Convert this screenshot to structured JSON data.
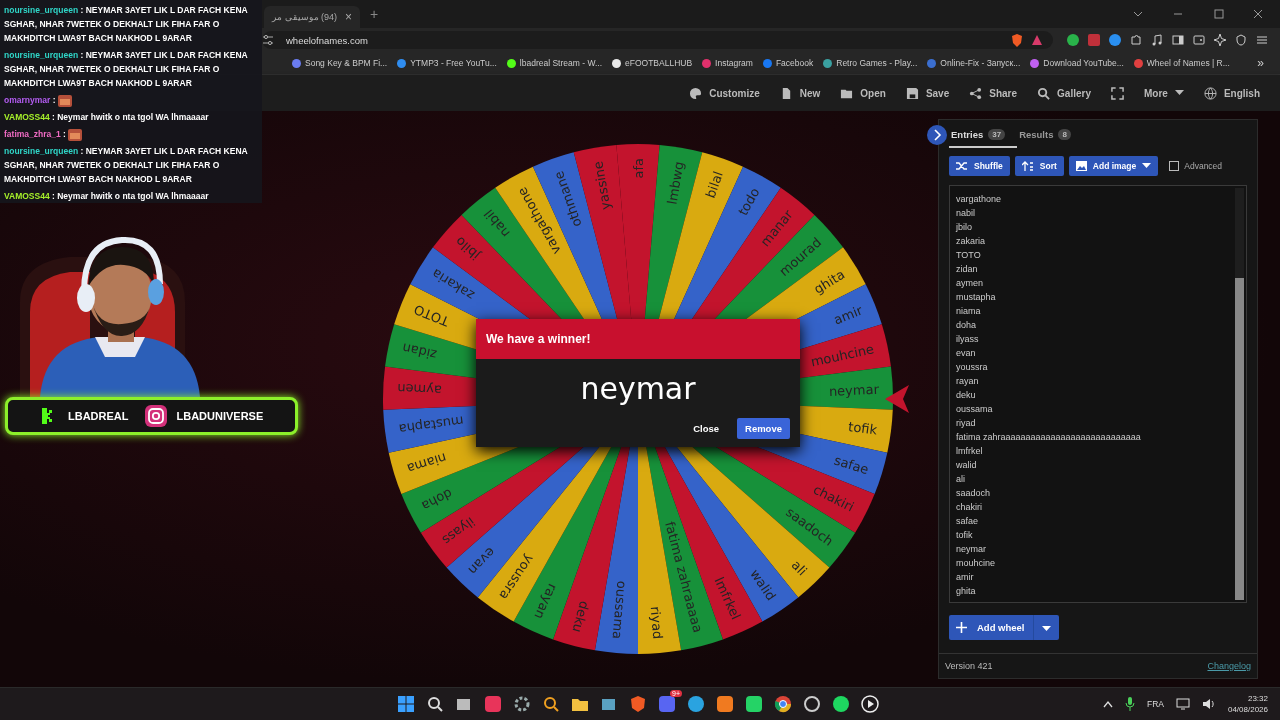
{
  "chat": [
    {
      "kind": "text",
      "user": "noursine_urqueen",
      "color": "#2fd6c8",
      "text": ": NEYMAR 3AYET LIK L DAR FACH KENA SGHAR, NHAR 7WETEK O DEKHALT LIK FIHA FAR O MAKHDITCH LWA9T BACH NAKHOD L 9ARAR"
    },
    {
      "kind": "text",
      "user": "noursine_urqueen",
      "color": "#2fd6c8",
      "text": ": NEYMAR 3AYET LIK L DAR FACH KENA SGHAR, NHAR 7WETEK O DEKHALT LIK FIHA FAR O MAKHDITCH LWA9T BACH NAKHOD L 9ARAR"
    },
    {
      "kind": "emote",
      "user": "omarnymar",
      "color": "#b25cf0",
      "text": ":"
    },
    {
      "kind": "text",
      "user": "VAMOSS44",
      "color": "#a6f02a",
      "text": ": Neymar hwitk o nta tgol WA lhmaaaar"
    },
    {
      "kind": "emote",
      "user": "fatima_zhra_1",
      "color": "#f06bc4",
      "text": ":"
    },
    {
      "kind": "text",
      "user": "noursine_urqueen",
      "color": "#2fd6c8",
      "text": ": NEYMAR 3AYET LIK L DAR FACH KENA SGHAR, NHAR 7WETEK O DEKHALT LIK FIHA FAR O MAKHDITCH LWA9T BACH NAKHOD L 9ARAR"
    },
    {
      "kind": "text",
      "user": "VAMOSS44",
      "color": "#a6f02a",
      "text": ": Neymar hwitk o nta tgol WA lhmaaaar"
    }
  ],
  "socials": [
    {
      "kind": "kick",
      "handle": "LBADREAL"
    },
    {
      "kind": "instagram",
      "handle": "LBADUNIVERSE"
    }
  ],
  "browser": {
    "tab": {
      "title": "(94) موسيقى مر",
      "close": "×"
    },
    "new_tab": "+",
    "address": "wheelofnames.com",
    "bookmarks": [
      {
        "label": "Song Key & BPM Fi...",
        "color": "#6a7cf0"
      },
      {
        "label": "YTMP3 - Free YouTu...",
        "color": "#2f8df0"
      },
      {
        "label": "lbadreal Stream - W...",
        "color": "#53fc18"
      },
      {
        "label": "eFOOTBALLHUB",
        "color": "#e8e8e8"
      },
      {
        "label": "Instagram",
        "color": "#e1306c"
      },
      {
        "label": "Facebook",
        "color": "#1877f2"
      },
      {
        "label": "Retro Games - Play...",
        "color": "#3aa0a0"
      },
      {
        "label": "Online-Fix - Запуск...",
        "color": "#3b6fd0"
      },
      {
        "label": "Download YouTube...",
        "color": "#c060f0"
      },
      {
        "label": "Wheel of Names | R...",
        "color": "#e04040"
      }
    ],
    "more": "»"
  },
  "header": {
    "items": [
      {
        "kind": "palette",
        "label": "Customize"
      },
      {
        "kind": "doc",
        "label": "New"
      },
      {
        "kind": "folder",
        "label": "Open"
      },
      {
        "kind": "save",
        "label": "Save"
      },
      {
        "kind": "share",
        "label": "Share"
      },
      {
        "kind": "search",
        "label": "Gallery"
      },
      {
        "kind": "fullscreen"
      },
      {
        "kind": "more",
        "label": "More"
      },
      {
        "kind": "globe",
        "label": "English"
      }
    ]
  },
  "wheel": {
    "slices": [
      {
        "label": "afa"
      },
      {
        "label": "lmbwg"
      },
      {
        "label": "bilal"
      },
      {
        "label": "todo"
      },
      {
        "label": "manar"
      },
      {
        "label": "mourad"
      },
      {
        "label": "ghita"
      },
      {
        "label": "amir"
      },
      {
        "label": "mouhcine"
      },
      {
        "label": "neymar"
      },
      {
        "label": "tofik"
      },
      {
        "label": "safae"
      },
      {
        "label": "chakiri"
      },
      {
        "label": "saadoch"
      },
      {
        "label": "ali"
      },
      {
        "label": "walid"
      },
      {
        "label": "lmfrkel"
      },
      {
        "label": "fatima zahraaaaa"
      },
      {
        "label": "riyad"
      },
      {
        "label": "oussama"
      },
      {
        "label": "deku"
      },
      {
        "label": "rayan"
      },
      {
        "label": "youssra"
      },
      {
        "label": "evan"
      },
      {
        "label": "ilyass"
      },
      {
        "label": "doha"
      },
      {
        "label": "niama"
      },
      {
        "label": "mustapha"
      },
      {
        "label": "aymen"
      },
      {
        "label": "zidan"
      },
      {
        "label": "TOTO"
      },
      {
        "label": "zakaria"
      },
      {
        "label": "jbilo"
      },
      {
        "label": "nabil"
      },
      {
        "label": "vargathone"
      },
      {
        "label": "othmane"
      },
      {
        "label": "yassine"
      }
    ]
  },
  "dialog": {
    "title": "We have a winner!",
    "winner": "neymar",
    "buttons": [
      {
        "kind": "plain",
        "label": "Close"
      },
      {
        "kind": "primary",
        "label": "Remove"
      }
    ]
  },
  "panel": {
    "tabs": [
      {
        "label": "Entries",
        "count": "37",
        "selected": true
      },
      {
        "label": "Results",
        "count": "8",
        "selected": false
      }
    ],
    "tools": [
      "Shuffle",
      "Sort",
      "Add image"
    ],
    "advanced": {
      "label": "Advanced",
      "checked": false
    },
    "entries": [
      "vargathone",
      "nabil",
      "jbilo",
      "zakaria",
      "TOTO",
      "zidan",
      "aymen",
      "mustapha",
      "niama",
      "doha",
      "ilyass",
      "evan",
      "youssra",
      "rayan",
      "deku",
      "oussama",
      "riyad",
      "fatima zahraaaaaaaaaaaaaaaaaaaaaaaaaaaa",
      "lmfrkel",
      "walid",
      "ali",
      "saadoch",
      "chakiri",
      "safae",
      "tofik",
      "neymar",
      "mouhcine",
      "amir",
      "ghita"
    ],
    "add_wheel": "Add wheel",
    "version": "Version 421",
    "changelog": "Changelog"
  },
  "taskbar": {
    "badge": "9+",
    "language": "FRA",
    "time": "23:32",
    "date": "04/08/2026"
  }
}
